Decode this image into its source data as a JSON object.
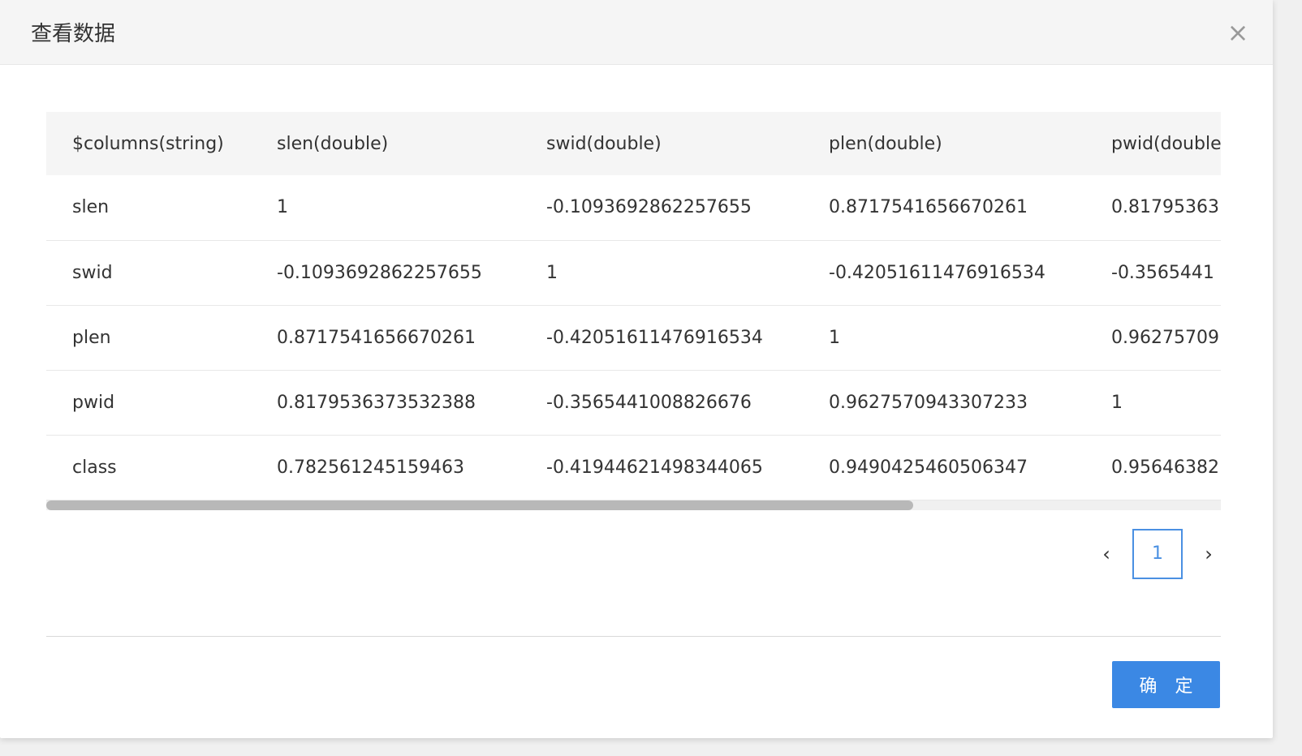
{
  "modal": {
    "title": "查看数据",
    "close_icon": "×"
  },
  "table": {
    "headers": [
      "$columns(string)",
      "slen(double)",
      "swid(double)",
      "plen(double)",
      "pwid(double"
    ],
    "rows": [
      [
        "slen",
        "1",
        "-0.1093692862257655",
        "0.8717541656670261",
        "0.81795363"
      ],
      [
        "swid",
        "-0.1093692862257655",
        "1",
        "-0.42051611476916534",
        "-0.3565441"
      ],
      [
        "plen",
        "0.8717541656670261",
        "-0.42051611476916534",
        "1",
        "0.96275709"
      ],
      [
        "pwid",
        "0.8179536373532388",
        "-0.3565441008826676",
        "0.9627570943307233",
        "1"
      ],
      [
        "class",
        "0.782561245159463",
        "-0.41944621498344065",
        "0.9490425460506347",
        "0.95646382"
      ]
    ]
  },
  "pagination": {
    "current_page": "1",
    "prev_arrow": "‹",
    "next_arrow": "›"
  },
  "footer": {
    "confirm_button": "确 定"
  }
}
